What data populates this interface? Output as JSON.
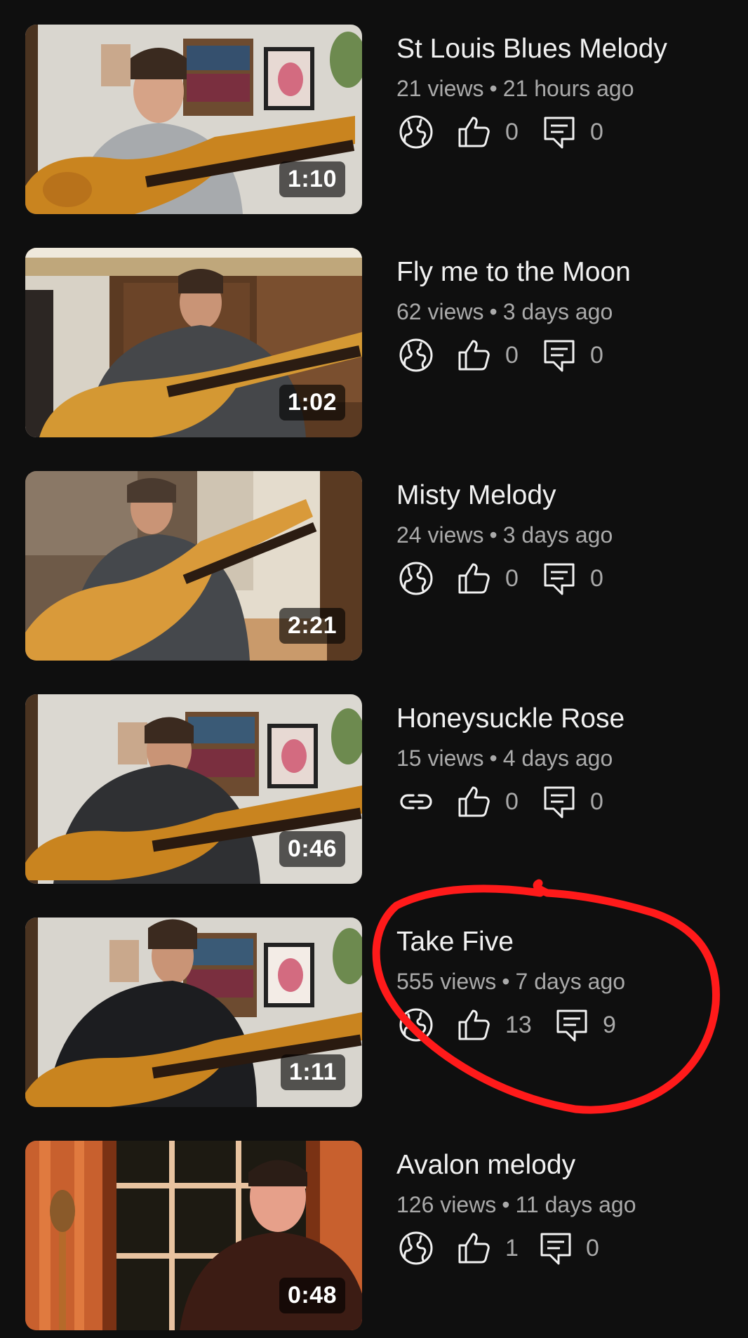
{
  "colors": {
    "background": "#0f0f0f",
    "title": "#f1f1f1",
    "meta": "#aaaaaa",
    "annotation": "#ff1a1a"
  },
  "videos": [
    {
      "title": "St Louis Blues Melody",
      "views": "21 views",
      "dot": "•",
      "age": "21 hours ago",
      "duration": "1:10",
      "visibility_icon": "globe-icon",
      "likes": "0",
      "comments": "0"
    },
    {
      "title": "Fly me to the Moon",
      "views": "62 views",
      "dot": "•",
      "age": "3 days ago",
      "duration": "1:02",
      "visibility_icon": "globe-icon",
      "likes": "0",
      "comments": "0"
    },
    {
      "title": "Misty Melody",
      "views": "24 views",
      "dot": "•",
      "age": "3 days ago",
      "duration": "2:21",
      "visibility_icon": "globe-icon",
      "likes": "0",
      "comments": "0"
    },
    {
      "title": "Honeysuckle Rose",
      "views": "15 views",
      "dot": "•",
      "age": "4 days ago",
      "duration": "0:46",
      "visibility_icon": "link-icon",
      "likes": "0",
      "comments": "0"
    },
    {
      "title": "Take Five",
      "views": "555 views",
      "dot": "•",
      "age": "7 days ago",
      "duration": "1:11",
      "visibility_icon": "globe-icon",
      "likes": "13",
      "comments": "9"
    },
    {
      "title": "Avalon melody",
      "views": "126 views",
      "dot": "•",
      "age": "11 days ago",
      "duration": "0:48",
      "visibility_icon": "globe-icon",
      "likes": "1",
      "comments": "0"
    }
  ]
}
